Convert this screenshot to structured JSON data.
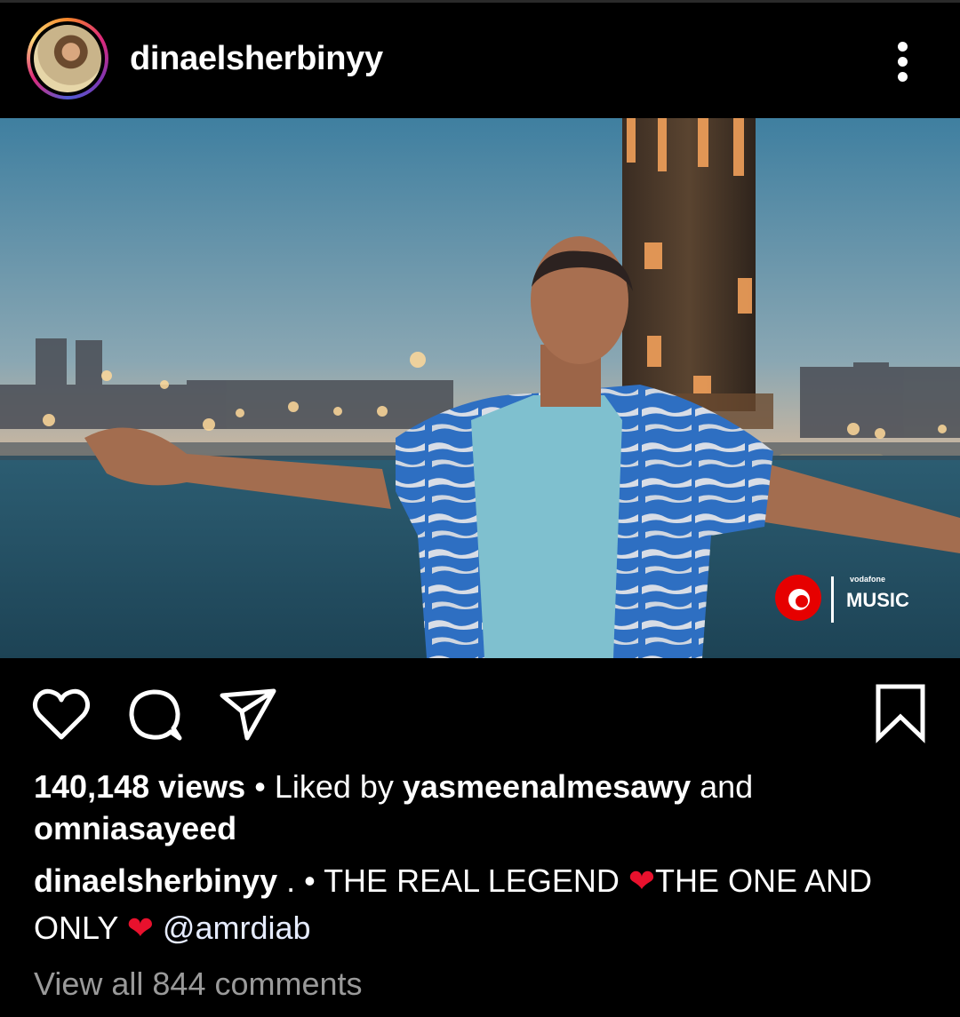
{
  "header": {
    "username": "dinaelsherbinyy"
  },
  "media": {
    "watermark_brand_small": "vodafone",
    "watermark_brand_big": "MUSIC"
  },
  "icons": [
    "heart-icon",
    "comment-icon",
    "share-icon",
    "bookmark-icon",
    "more-icon"
  ],
  "stats": {
    "views": "140,148 views",
    "separator": " • ",
    "liked_by_prefix": "Liked by ",
    "liked_user_1": "yasmeenalmesawy",
    "and": " and",
    "liked_user_2": "omniasayeed"
  },
  "caption": {
    "author": "dinaelsherbinyy",
    "part1": " . • THE REAL LEGEND ",
    "heart1": "❤",
    "part2": "THE ONE AND",
    "part3": "ONLY ",
    "heart2": "❤",
    "part4": " ",
    "mention": "@amrdiab"
  },
  "comments": {
    "view_all": "View all 844 comments"
  },
  "colors": {
    "background": "#000000",
    "heart": "#e8112d",
    "gray_text": "#9a9a9a"
  }
}
